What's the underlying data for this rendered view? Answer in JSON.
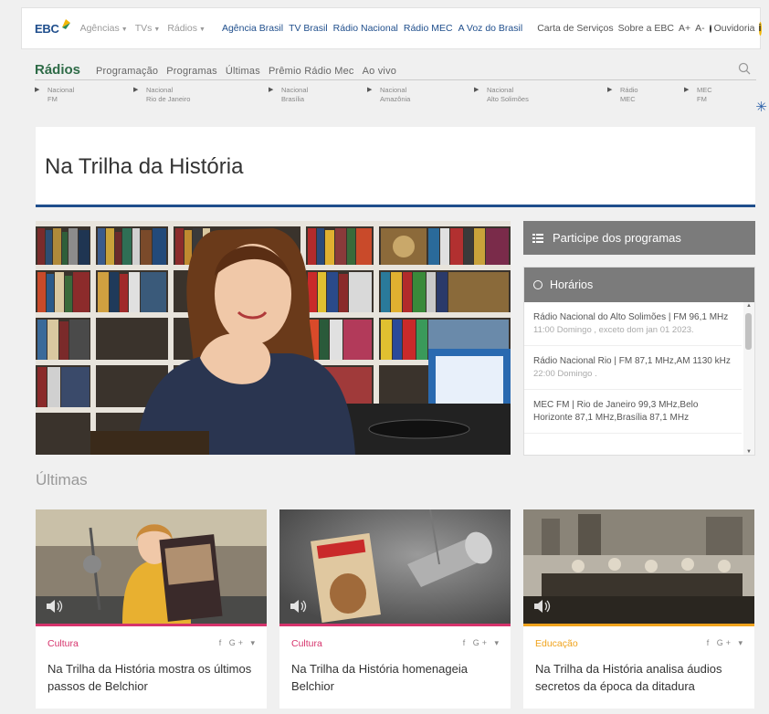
{
  "topbar": {
    "logo": "EBC",
    "dropdowns": [
      "Agências",
      "TVs",
      "Rádios"
    ],
    "links": [
      "Agência Brasil",
      "TV Brasil",
      "Rádio Nacional",
      "Rádio MEC",
      "A Voz do Brasil"
    ],
    "carta": "Carta de Serviços",
    "sobre": "Sobre a EBC",
    "font_up": "A+",
    "font_down": "A-",
    "ouvidoria": "Ouvidoria",
    "ouvidoria_icon": "i"
  },
  "radios": {
    "title": "Rádios",
    "nav": [
      "Programação",
      "Programas",
      "Últimas",
      "Prêmio Rádio Mec",
      "Ao vivo"
    ],
    "stations": [
      {
        "l1": "Nacional",
        "l2": "FM"
      },
      {
        "l1": "Nacional",
        "l2": "Rio de Janeiro"
      },
      {
        "l1": "Nacional",
        "l2": "Brasília"
      },
      {
        "l1": "Nacional",
        "l2": "Amazônia"
      },
      {
        "l1": "Nacional",
        "l2": "Alto Solimões"
      },
      {
        "l1": "Rádio",
        "l2": "MEC"
      },
      {
        "l1": "MEC",
        "l2": "FM"
      }
    ]
  },
  "page": {
    "title": "Na Trilha da História"
  },
  "sidebar": {
    "participe": "Participe dos programas",
    "horarios_title": "Horários",
    "horarios": [
      {
        "name": "Rádio Nacional do Alto Solimões | FM 96,1 MHz",
        "time": "11:00 Domingo , exceto dom jan 01 2023."
      },
      {
        "name": "Rádio Nacional Rio | FM 87,1 MHz,AM 1130 kHz",
        "time": "22:00 Domingo ."
      },
      {
        "name": "MEC FM | Rio de Janeiro 99,3 MHz,Belo Horizonte 87,1 MHz,Brasília 87,1 MHz",
        "time": ""
      }
    ]
  },
  "ultimas_title": "Últimas",
  "cards": [
    {
      "category": "Cultura",
      "headline": "Na Trilha da História mostra os últimos passos de Belchior",
      "color": "#d6336c"
    },
    {
      "category": "Cultura",
      "headline": "Na Trilha da História homenageia Belchior",
      "color": "#d6336c"
    },
    {
      "category": "Educação",
      "headline": "Na Trilha da História analisa áudios secretos da época da ditadura",
      "color": "#f0a31c"
    }
  ],
  "social": "f G+ ▾",
  "colors": {
    "brand_blue": "#1f4e8c",
    "radios_green": "#2e6b47",
    "panel_gray": "#7b7b7b"
  }
}
